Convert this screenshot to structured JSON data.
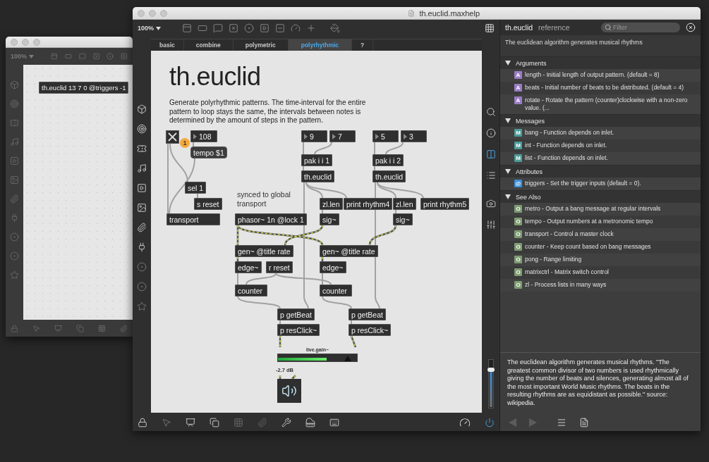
{
  "background_window": {
    "zoom": "100%",
    "object": "th.euclid 13 7 0 @triggers -1"
  },
  "window": {
    "title": "th.euclid.maxhelp"
  },
  "toolbar": {
    "zoom": "100%"
  },
  "tabs": [
    {
      "label": "basic",
      "selected": false
    },
    {
      "label": "combine",
      "selected": false
    },
    {
      "label": "polymetric",
      "selected": false
    },
    {
      "label": "polyrhythmic",
      "selected": true
    },
    {
      "label": "?",
      "selected": false
    }
  ],
  "patch": {
    "title": "th.euclid",
    "description": "Generate polyrhythmic patterns. The time-interval for the entire pattern to loop stays the same, the intervals between notes is determined by the amount of steps in the pattern.",
    "objects": [
      {
        "kind": "toggle",
        "on": true,
        "badge": "1"
      },
      {
        "kind": "number",
        "text": "108"
      },
      {
        "kind": "message",
        "text": "tempo $1"
      },
      {
        "kind": "object",
        "text": "sel 1"
      },
      {
        "kind": "object",
        "text": "s reset"
      },
      {
        "kind": "object",
        "text": "transport"
      },
      {
        "kind": "comment",
        "text": "synced to global transport"
      },
      {
        "kind": "object",
        "text": "phasor~ 1n @lock 1"
      },
      {
        "kind": "number",
        "text": "9"
      },
      {
        "kind": "number",
        "text": "7"
      },
      {
        "kind": "object",
        "text": "pak i i 1"
      },
      {
        "kind": "object",
        "text": "th.euclid"
      },
      {
        "kind": "object",
        "text": "zl.len"
      },
      {
        "kind": "object",
        "text": "print rhythm4"
      },
      {
        "kind": "object",
        "text": "sig~"
      },
      {
        "kind": "number",
        "text": "5"
      },
      {
        "kind": "number",
        "text": "3"
      },
      {
        "kind": "object",
        "text": "pak i i 2"
      },
      {
        "kind": "object",
        "text": "th.euclid"
      },
      {
        "kind": "object",
        "text": "zl.len"
      },
      {
        "kind": "object",
        "text": "print rhythm5"
      },
      {
        "kind": "object",
        "text": "sig~"
      },
      {
        "kind": "object",
        "text": "gen~ @title rate"
      },
      {
        "kind": "object",
        "text": "gen~ @title rate"
      },
      {
        "kind": "object",
        "text": "edge~"
      },
      {
        "kind": "object",
        "text": "r reset"
      },
      {
        "kind": "object",
        "text": "edge~"
      },
      {
        "kind": "object",
        "text": "counter"
      },
      {
        "kind": "object",
        "text": "counter"
      },
      {
        "kind": "object",
        "text": "p getBeat"
      },
      {
        "kind": "object",
        "text": "p resClick~"
      },
      {
        "kind": "object",
        "text": "p getBeat"
      },
      {
        "kind": "object",
        "text": "p resClick~"
      }
    ],
    "gain": {
      "label": "live.gain~",
      "reading": "-2.7 dB",
      "meter": {
        "level": 0.62
      },
      "slider": {
        "level": 0.88
      }
    }
  },
  "sidebar": {
    "volume": {
      "level": 0.8
    }
  },
  "reference": {
    "title": "th.euclid",
    "subtitle": "reference",
    "filter_placeholder": "Filter",
    "summary": "The euclidean algorithm generates musical rhythms",
    "sections": [
      {
        "title": "Arguments",
        "expanded": true,
        "items": [
          {
            "kind": "argument",
            "badge": "A",
            "text": "length - Initial length of output pattern. (default = 8)"
          },
          {
            "kind": "argument",
            "badge": "A",
            "text": "beats - Initial number of beats to be distributed. (default = 4)"
          },
          {
            "kind": "argument",
            "badge": "A",
            "text": "rotate - Rotate the pattern (counter)clockwise with a non-zero value. (..."
          }
        ]
      },
      {
        "title": "Messages",
        "expanded": true,
        "items": [
          {
            "kind": "message",
            "badge": "M",
            "text": "bang - Function depends on inlet."
          },
          {
            "kind": "message",
            "badge": "M",
            "text": "int - Function depends on inlet."
          },
          {
            "kind": "message",
            "badge": "M",
            "text": "list - Function depends on inlet."
          }
        ]
      },
      {
        "title": "Attributes",
        "expanded": true,
        "items": [
          {
            "kind": "attribute",
            "badge": "@",
            "text": "triggers - Set the trigger inputs (default = 0)."
          }
        ]
      },
      {
        "title": "See Also",
        "expanded": true,
        "items": [
          {
            "kind": "object",
            "badge": "O",
            "text": "metro - Output a bang message at regular intervals"
          },
          {
            "kind": "object",
            "badge": "O",
            "text": "tempo - Output numbers at a metronomic tempo"
          },
          {
            "kind": "object",
            "badge": "O",
            "text": "transport - Control a master clock"
          },
          {
            "kind": "object",
            "badge": "O",
            "text": "counter - Keep count based on bang messages"
          },
          {
            "kind": "object",
            "badge": "O",
            "text": "pong - Range limiting"
          },
          {
            "kind": "object",
            "badge": "O",
            "text": "matrixctrl - Matrix switch control"
          },
          {
            "kind": "object",
            "badge": "O",
            "text": "zl - Process lists in many ways"
          }
        ]
      }
    ],
    "description": "The euclidean algorithm generates musical rhythms. \"The greatest common divisor of two numbers is used rhythmically giving the number of beats and silences, generating almost all of the most important World Music rhythms. The beats in the resulting rhythms are as equidistant as possible.\" source: wikipedia."
  }
}
